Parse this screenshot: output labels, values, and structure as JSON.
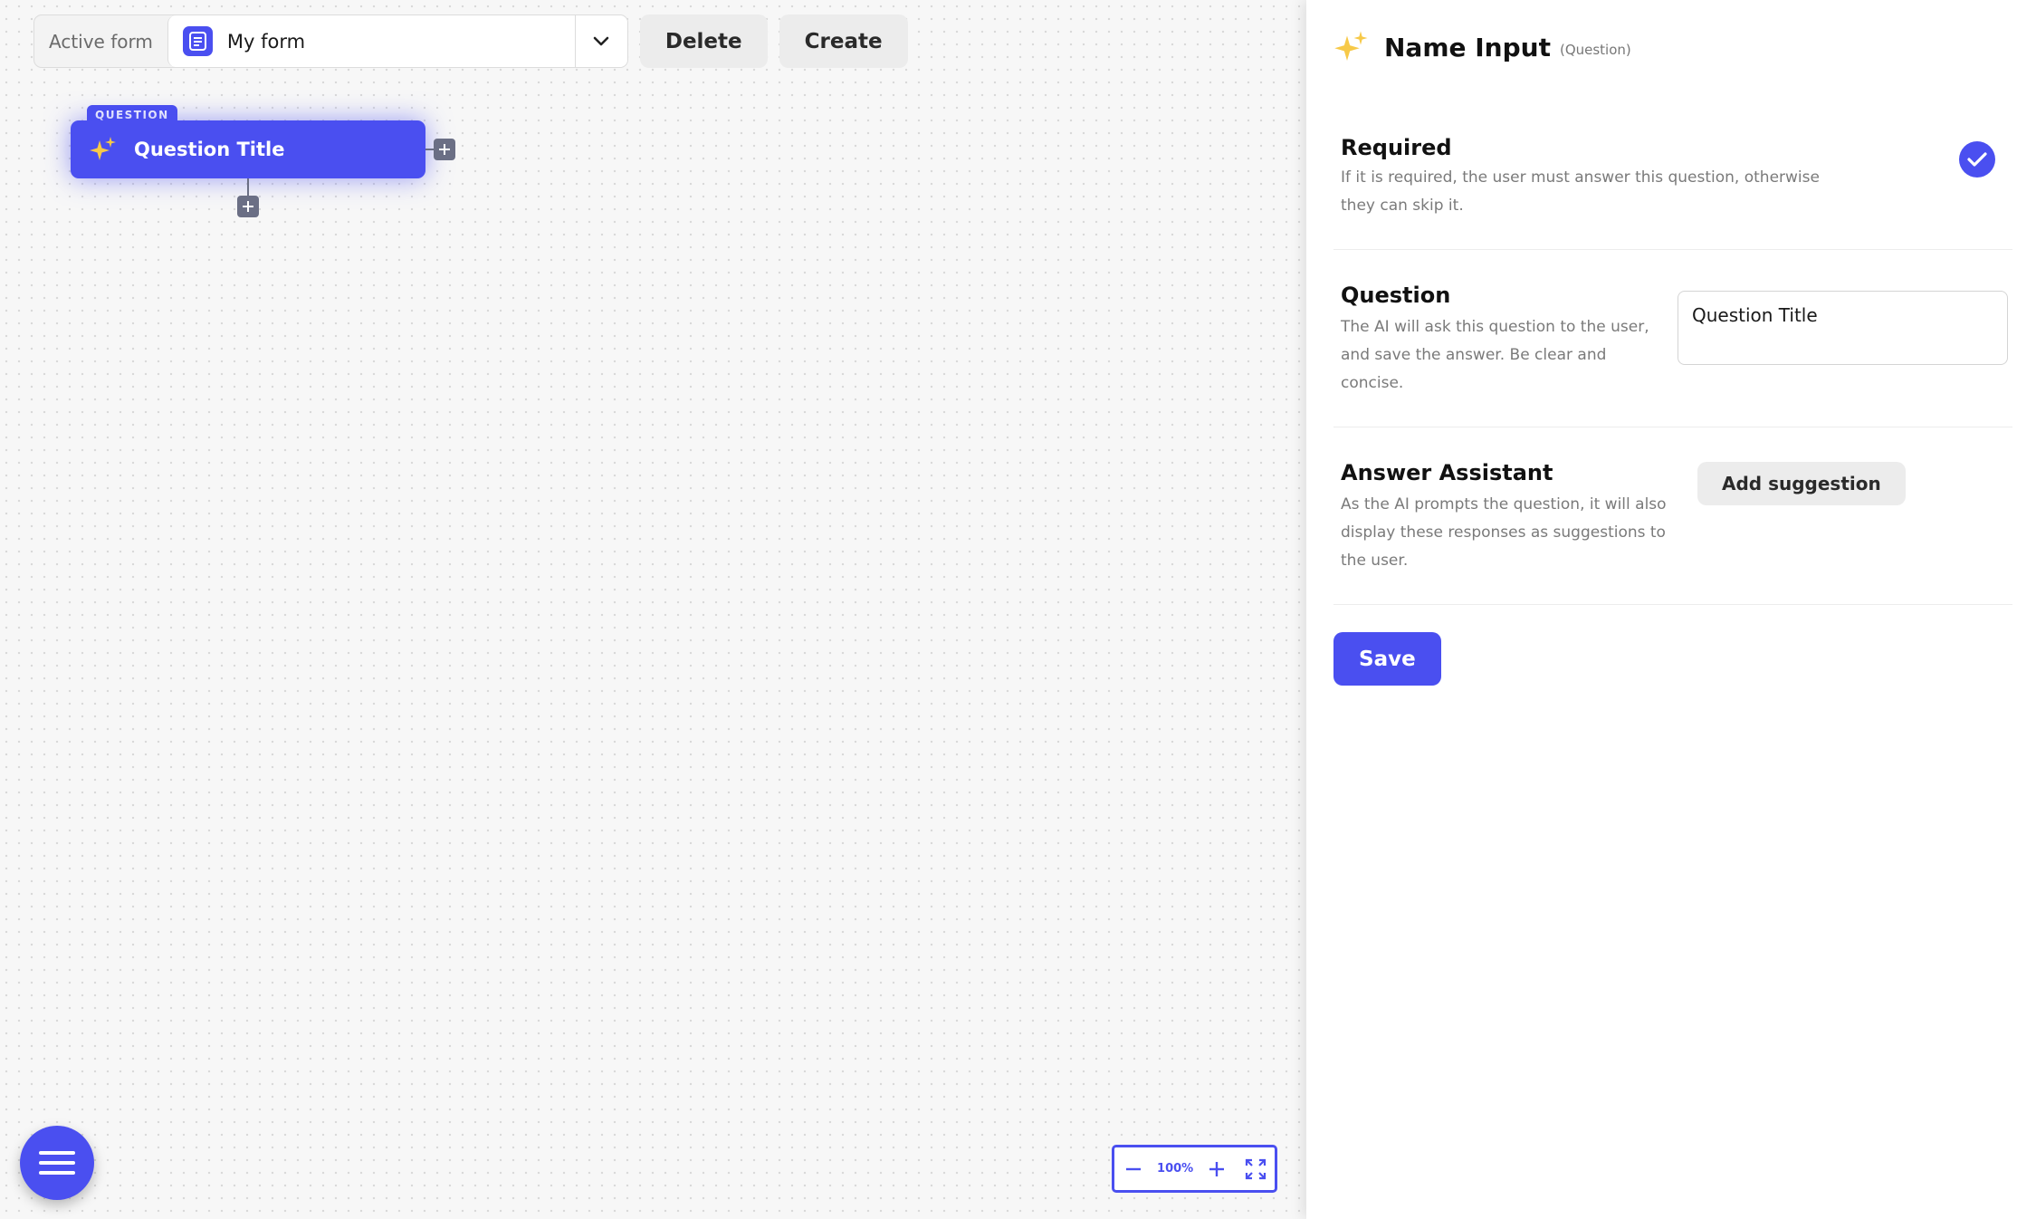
{
  "toolbar": {
    "active_form_label": "Active form",
    "selected_form": "My form",
    "delete_label": "Delete",
    "create_label": "Create"
  },
  "node": {
    "tag": "QUESTION",
    "title": "Question Title"
  },
  "zoom": {
    "level": "100%"
  },
  "panel": {
    "title": "Name Input",
    "kind": "(Question)",
    "required": {
      "title": "Required",
      "description": "If it is required, the user must answer this question, otherwise they can skip it.",
      "checked": true
    },
    "question": {
      "title": "Question",
      "description": "The AI will ask this question to the user, and save the answer. Be clear and concise.",
      "value": "Question Title"
    },
    "answer_assistant": {
      "title": "Answer Assistant",
      "description": "As the AI prompts the question, it will also display these responses as suggestions to the user.",
      "add_label": "Add suggestion"
    },
    "save_label": "Save"
  },
  "colors": {
    "accent": "#4a4ff0",
    "canvas_bg": "#f7f7f7",
    "button_bg": "#ececec"
  },
  "icons": {
    "node": "sparkles-icon",
    "menu": "hamburger-menu-icon",
    "form": "document-icon"
  }
}
